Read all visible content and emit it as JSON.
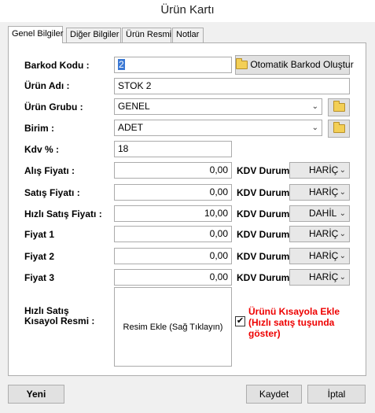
{
  "window": {
    "title": "Ürün Kartı"
  },
  "tabs": [
    {
      "label": "Genel Bilgiler"
    },
    {
      "label": "Diğer Bilgiler"
    },
    {
      "label": "Ürün Resmi"
    },
    {
      "label": "Notlar"
    }
  ],
  "form": {
    "barkod": {
      "label": "Barkod Kodu :",
      "value": "2",
      "button": "Otomatik Barkod Oluştur"
    },
    "urun_adi": {
      "label": "Ürün Adı :",
      "value": "STOK 2"
    },
    "urun_grubu": {
      "label": "Ürün Grubu :",
      "value": "GENEL"
    },
    "birim": {
      "label": "Birim :",
      "value": "ADET"
    },
    "kdv": {
      "label": "Kdv %  :",
      "value": "18"
    },
    "kdv_durum_label": "KDV Durum",
    "prices": [
      {
        "label": "Alış Fiyatı :",
        "value": "0,00",
        "kdv": "HARİÇ"
      },
      {
        "label": "Satış Fiyatı :",
        "value": "0,00",
        "kdv": "HARİÇ"
      },
      {
        "label": "Hızlı Satış Fiyatı :",
        "value": "10,00",
        "kdv": "DAHİL"
      },
      {
        "label": "Fiyat 1",
        "value": "0,00",
        "kdv": "HARİÇ"
      },
      {
        "label": "Fiyat 2",
        "value": "0,00",
        "kdv": "HARİÇ"
      },
      {
        "label": "Fiyat 3",
        "value": "0,00",
        "kdv": "HARİÇ"
      }
    ],
    "kisayol": {
      "label_line1": "Hızlı Satış",
      "label_line2": "Kısayol Resmi :",
      "image_hint": "Resim Ekle (Sağ Tıklayın)",
      "checkbox_checked": true,
      "checkbox_mark": "✔",
      "checkbox_line1": "Ürünü Kısayola Ekle",
      "checkbox_line2": "(Hızlı satış tuşunda",
      "checkbox_line3": "göster)"
    }
  },
  "footer": {
    "new": "Yeni",
    "save": "Kaydet",
    "cancel": "İptal"
  },
  "colors": {
    "accent_red": "#e00000",
    "folder": "#f3cf56"
  }
}
